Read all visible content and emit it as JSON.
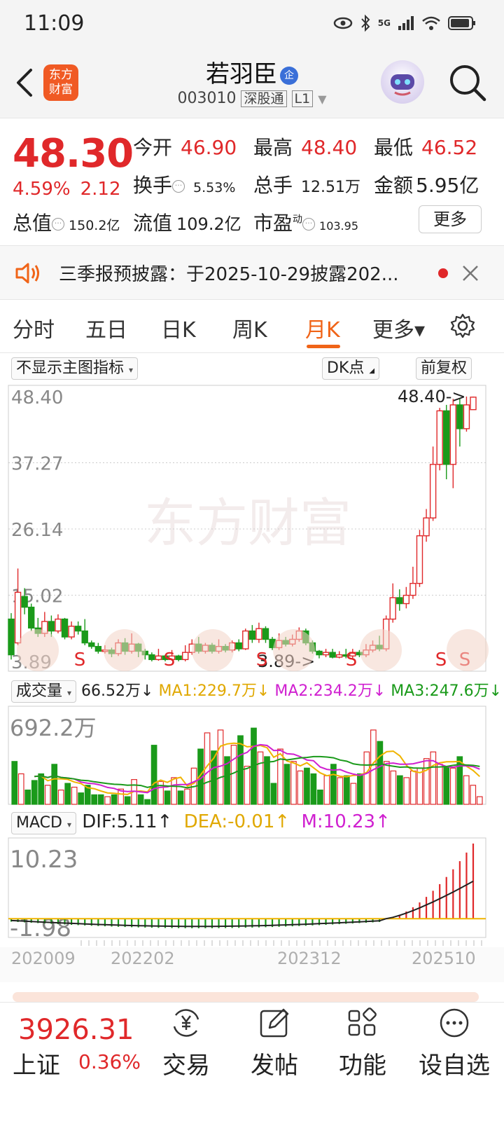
{
  "status_bar": {
    "time": "11:09",
    "network_label": "5G"
  },
  "header": {
    "logo_text_line1": "东方",
    "logo_text_line2": "财富",
    "stock_name": "若羽臣",
    "badge": "企",
    "stock_code": "003010",
    "exchange_tag": "深股通",
    "level_tag": "L1"
  },
  "quote": {
    "price": "48.30",
    "change_pct": "4.59%",
    "change_amt": "2.12",
    "open_label": "今开",
    "open_value": "46.90",
    "high_label": "最高",
    "high_value": "48.40",
    "low_label": "最低",
    "low_value": "46.52",
    "turnover_label": "换手",
    "turnover_value": "5.53%",
    "volume_label": "总手",
    "volume_value": "12.51万",
    "amount_label": "金额",
    "amount_value": "5.95亿",
    "mktcap_label": "总值",
    "mktcap_value": "150.2亿",
    "float_label": "流值",
    "float_value": "109.2亿",
    "pe_label": "市盈",
    "pe_sup": "动",
    "pe_value": "103.95",
    "more_label": "更多"
  },
  "notice": {
    "text": "三季报预披露：于2025-10-29披露202..."
  },
  "tabs": [
    {
      "label": "分时"
    },
    {
      "label": "五日"
    },
    {
      "label": "日K"
    },
    {
      "label": "周K"
    },
    {
      "label": "月K",
      "active": true
    },
    {
      "label": "更多▾"
    }
  ],
  "chart_controls": {
    "indicator_select": "不显示主图指标",
    "dk_select": "DK点",
    "adjust_label": "前复权",
    "watermark": "东方财富"
  },
  "colors": {
    "up": "#e0282a",
    "down": "#1a9a1a",
    "accent": "#f06418",
    "ma1": "#f0b400",
    "ma2": "#d020d0",
    "ma3": "#1a9a1a"
  },
  "volume_panel": {
    "select": "成交量",
    "current": "66.52万↓",
    "ma1": "MA1:229.7万↓",
    "ma2": "MA2:234.2万↓",
    "ma3": "MA3:247.6万↓",
    "max_label": "692.2万"
  },
  "macd_panel": {
    "select": "MACD",
    "dif": "DIF:5.11↑",
    "dea": "DEA:-0.01↑",
    "m": "M:10.23↑",
    "max_label": "10.23",
    "min_label": "-1.98"
  },
  "chart_data": {
    "type": "candlestick",
    "period": "monthly",
    "y_ticks": [
      "48.40",
      "37.27",
      "26.14",
      "15.02",
      "3.89"
    ],
    "ylim": [
      3.89,
      48.4
    ],
    "x_ticks": [
      "202009",
      "202202",
      "202312",
      "202510"
    ],
    "high_annotation": "48.40->",
    "low_annotation": "3.89->",
    "signal_marker": "S",
    "candles": [
      {
        "o": 11.0,
        "c": 5.0,
        "h": 12.0,
        "l": 4.2
      },
      {
        "o": 7.0,
        "c": 15.5,
        "h": 19.5,
        "l": 6.6
      },
      {
        "o": 14.8,
        "c": 13.0,
        "h": 16.2,
        "l": 11.8
      },
      {
        "o": 13.0,
        "c": 9.5,
        "h": 13.6,
        "l": 9.0
      },
      {
        "o": 9.5,
        "c": 8.6,
        "h": 11.2,
        "l": 8.0
      },
      {
        "o": 8.6,
        "c": 10.6,
        "h": 12.2,
        "l": 8.0
      },
      {
        "o": 10.6,
        "c": 9.0,
        "h": 11.6,
        "l": 8.0
      },
      {
        "o": 9.0,
        "c": 11.0,
        "h": 11.8,
        "l": 8.6
      },
      {
        "o": 11.0,
        "c": 8.0,
        "h": 11.2,
        "l": 7.6
      },
      {
        "o": 8.0,
        "c": 9.8,
        "h": 10.6,
        "l": 7.6
      },
      {
        "o": 9.8,
        "c": 9.0,
        "h": 10.6,
        "l": 8.4
      },
      {
        "o": 9.0,
        "c": 7.0,
        "h": 11.0,
        "l": 6.6
      },
      {
        "o": 7.0,
        "c": 6.4,
        "h": 7.4,
        "l": 6.0
      },
      {
        "o": 6.4,
        "c": 5.6,
        "h": 7.0,
        "l": 5.2
      },
      {
        "o": 5.6,
        "c": 5.8,
        "h": 6.6,
        "l": 5.2
      },
      {
        "o": 5.8,
        "c": 5.2,
        "h": 6.2,
        "l": 4.6
      },
      {
        "o": 5.2,
        "c": 7.0,
        "h": 7.6,
        "l": 4.8
      },
      {
        "o": 7.0,
        "c": 5.6,
        "h": 7.8,
        "l": 5.0
      },
      {
        "o": 5.6,
        "c": 6.8,
        "h": 8.6,
        "l": 5.2
      },
      {
        "o": 6.8,
        "c": 5.6,
        "h": 7.0,
        "l": 4.6
      },
      {
        "o": 5.6,
        "c": 5.0,
        "h": 6.0,
        "l": 4.2
      },
      {
        "o": 5.0,
        "c": 4.2,
        "h": 5.4,
        "l": 3.89
      },
      {
        "o": 4.2,
        "c": 4.8,
        "h": 6.0,
        "l": 4.0
      },
      {
        "o": 4.8,
        "c": 4.2,
        "h": 5.0,
        "l": 3.9
      },
      {
        "o": 4.2,
        "c": 4.8,
        "h": 5.8,
        "l": 4.0
      },
      {
        "o": 4.8,
        "c": 4.2,
        "h": 5.0,
        "l": 3.9
      },
      {
        "o": 4.2,
        "c": 5.4,
        "h": 6.6,
        "l": 3.9
      },
      {
        "o": 5.4,
        "c": 6.8,
        "h": 7.6,
        "l": 5.0
      },
      {
        "o": 6.8,
        "c": 5.6,
        "h": 8.0,
        "l": 5.2
      },
      {
        "o": 5.6,
        "c": 6.6,
        "h": 7.0,
        "l": 5.2
      },
      {
        "o": 6.6,
        "c": 5.6,
        "h": 7.0,
        "l": 5.2
      },
      {
        "o": 5.6,
        "c": 6.4,
        "h": 7.6,
        "l": 5.2
      },
      {
        "o": 6.4,
        "c": 5.8,
        "h": 6.8,
        "l": 5.4
      },
      {
        "o": 5.8,
        "c": 7.0,
        "h": 7.4,
        "l": 5.4
      },
      {
        "o": 7.0,
        "c": 6.0,
        "h": 7.6,
        "l": 5.6
      },
      {
        "o": 6.0,
        "c": 9.0,
        "h": 9.4,
        "l": 5.8
      },
      {
        "o": 9.0,
        "c": 7.6,
        "h": 10.0,
        "l": 7.0
      },
      {
        "o": 7.6,
        "c": 9.4,
        "h": 10.4,
        "l": 7.0
      },
      {
        "o": 9.4,
        "c": 7.6,
        "h": 9.8,
        "l": 7.0
      },
      {
        "o": 7.6,
        "c": 6.2,
        "h": 8.0,
        "l": 5.8
      },
      {
        "o": 6.2,
        "c": 7.4,
        "h": 8.6,
        "l": 5.8
      },
      {
        "o": 7.4,
        "c": 6.8,
        "h": 8.0,
        "l": 6.4
      },
      {
        "o": 6.8,
        "c": 7.6,
        "h": 8.4,
        "l": 6.4
      },
      {
        "o": 7.6,
        "c": 9.0,
        "h": 9.6,
        "l": 7.2
      },
      {
        "o": 9.0,
        "c": 7.0,
        "h": 9.4,
        "l": 6.6
      },
      {
        "o": 7.0,
        "c": 5.6,
        "h": 7.4,
        "l": 5.2
      },
      {
        "o": 5.6,
        "c": 5.0,
        "h": 5.8,
        "l": 4.4
      },
      {
        "o": 5.0,
        "c": 5.4,
        "h": 6.0,
        "l": 4.6
      },
      {
        "o": 5.4,
        "c": 4.6,
        "h": 6.0,
        "l": 4.4
      },
      {
        "o": 4.6,
        "c": 5.0,
        "h": 5.6,
        "l": 4.4
      },
      {
        "o": 5.0,
        "c": 4.8,
        "h": 6.0,
        "l": 4.4
      },
      {
        "o": 4.8,
        "c": 5.4,
        "h": 6.0,
        "l": 4.4
      },
      {
        "o": 5.4,
        "c": 5.0,
        "h": 5.8,
        "l": 4.6
      },
      {
        "o": 5.0,
        "c": 5.8,
        "h": 6.8,
        "l": 4.6
      },
      {
        "o": 5.8,
        "c": 6.6,
        "h": 7.4,
        "l": 5.4
      },
      {
        "o": 6.6,
        "c": 6.0,
        "h": 8.2,
        "l": 5.6
      },
      {
        "o": 6.0,
        "c": 11.0,
        "h": 11.6,
        "l": 5.6
      },
      {
        "o": 11.0,
        "c": 14.6,
        "h": 17.0,
        "l": 10.4
      },
      {
        "o": 14.6,
        "c": 13.6,
        "h": 16.0,
        "l": 12.4
      },
      {
        "o": 13.6,
        "c": 15.0,
        "h": 16.4,
        "l": 12.8
      },
      {
        "o": 15.0,
        "c": 17.0,
        "h": 19.8,
        "l": 14.4
      },
      {
        "o": 17.0,
        "c": 25.0,
        "h": 26.0,
        "l": 16.4
      },
      {
        "o": 25.0,
        "c": 28.0,
        "h": 29.5,
        "l": 24.0
      },
      {
        "o": 28.0,
        "c": 37.0,
        "h": 40.0,
        "l": 27.5
      },
      {
        "o": 37.0,
        "c": 46.0,
        "h": 46.5,
        "l": 36.0
      },
      {
        "o": 46.0,
        "c": 37.0,
        "h": 47.0,
        "l": 34.5
      },
      {
        "o": 37.0,
        "c": 47.0,
        "h": 48.0,
        "l": 33.0
      },
      {
        "o": 47.0,
        "c": 43.0,
        "h": 48.0,
        "l": 40.0
      },
      {
        "o": 43.0,
        "c": 47.0,
        "h": 48.4,
        "l": 42.5
      },
      {
        "o": 46.2,
        "c": 48.3,
        "h": 48.4,
        "l": 46.5
      }
    ],
    "volume_max": 692.2,
    "macd_range": [
      -1.98,
      10.23
    ]
  },
  "bottom_bar": {
    "index_value": "3926.31",
    "index_name": "上证",
    "index_change": "0.36%",
    "nav": [
      {
        "label": "交易"
      },
      {
        "label": "发帖"
      },
      {
        "label": "功能"
      },
      {
        "label": "设自选"
      }
    ]
  }
}
